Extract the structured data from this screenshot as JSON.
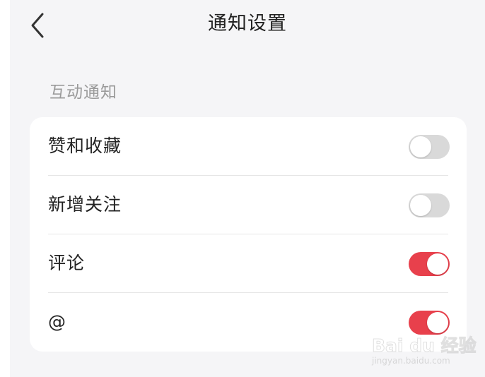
{
  "header": {
    "title": "通知设置",
    "back_icon": "chevron-left-icon"
  },
  "sections": [
    {
      "title": "互动通知",
      "items": [
        {
          "label": "赞和收藏",
          "enabled": false
        },
        {
          "label": "新增关注",
          "enabled": false
        },
        {
          "label": "评论",
          "enabled": true
        },
        {
          "label": "@",
          "enabled": true
        }
      ]
    }
  ],
  "watermark": {
    "line1": "Bai du 经验",
    "line2": "jingyan.baidu.com"
  },
  "colors": {
    "accent_on": "#e8404c",
    "toggle_off": "#d9d9d9",
    "background": "#f5f5f7",
    "card": "#ffffff"
  }
}
